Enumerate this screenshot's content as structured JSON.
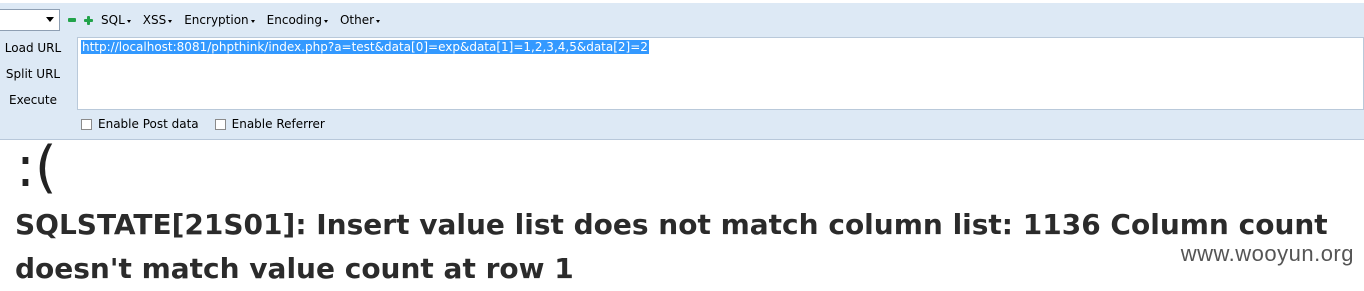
{
  "menu": {
    "sql": "SQL",
    "xss": "XSS",
    "encryption": "Encryption",
    "encoding": "Encoding",
    "other": "Other"
  },
  "side_buttons": {
    "load_url": "Load URL",
    "split_url": "Split URL",
    "execute": "Execute"
  },
  "url_box": {
    "value": "http://localhost:8081/phpthink/index.php?a=test&data[0]=exp&data[1]=1,2,3,4,5&data[2]=2"
  },
  "checkboxes": {
    "post_data": "Enable Post data",
    "referrer": "Enable Referrer"
  },
  "page": {
    "sad_face": ":(",
    "error_message": "SQLSTATE[21S01]: Insert value list does not match column list: 1136 Column count doesn't match value count at row 1",
    "watermark": "www.wooyun.org"
  },
  "icons": {
    "minus": "minus-icon",
    "plus": "plus-icon",
    "caret": "caret-down-icon"
  },
  "colors": {
    "toolbar_bg": "#dde9f5",
    "selection": "#3399ff",
    "green_icons": "#22a34a"
  }
}
